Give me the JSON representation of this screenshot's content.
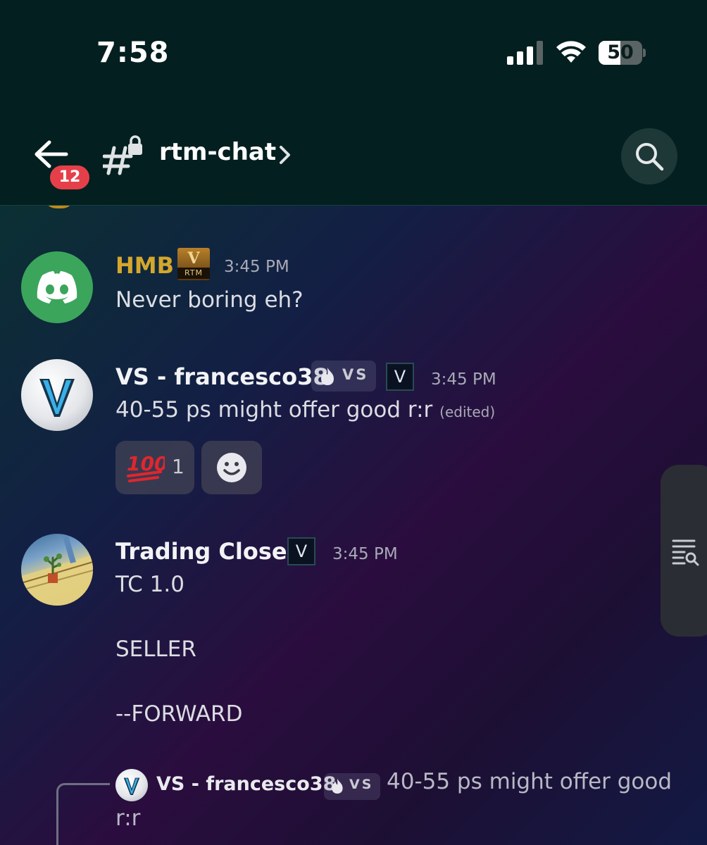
{
  "status_bar": {
    "time": "7:58",
    "battery": "50",
    "battery_level_percent": 50,
    "icons": [
      "signal-icon",
      "wifi-icon",
      "battery-icon"
    ]
  },
  "header": {
    "unread_count": "12",
    "channel_name": "rtm-chat",
    "icons": [
      "back-arrow-icon",
      "locked-channel-hash-icon",
      "chevron-right-icon",
      "search-icon"
    ]
  },
  "messages": [
    {
      "username": "HMB",
      "username_color": "#d4a72c",
      "badge": "RTM",
      "timestamp": "3:45 PM",
      "text": "Never boring eh?"
    },
    {
      "username": "VS - francesco38",
      "tag": "VS",
      "role_badge": "V",
      "timestamp": "3:45 PM",
      "text": "40-55 ps might offer good r:r",
      "edited_label": "(edited)",
      "reactions": [
        {
          "emoji": "100-emoji-icon",
          "emoji_glyph": "100",
          "count": "1"
        },
        {
          "emoji": "add-reaction-icon"
        }
      ]
    },
    {
      "username": "Trading Closed",
      "role_badge": "V",
      "timestamp": "3:45 PM",
      "lines": [
        "TC 1.0",
        "SELLER",
        "--FORWARD"
      ]
    }
  ],
  "reply_preview": {
    "username": "VS - francesco38",
    "tag": "VS",
    "text_line1": "40-55 ps might offer good",
    "text_line2": "r:r"
  },
  "colors": {
    "header_bg": "#041f1f",
    "badge_red": "#e5404a",
    "discord_green": "#3ba55c",
    "hmb_gold": "#d4a72c"
  }
}
